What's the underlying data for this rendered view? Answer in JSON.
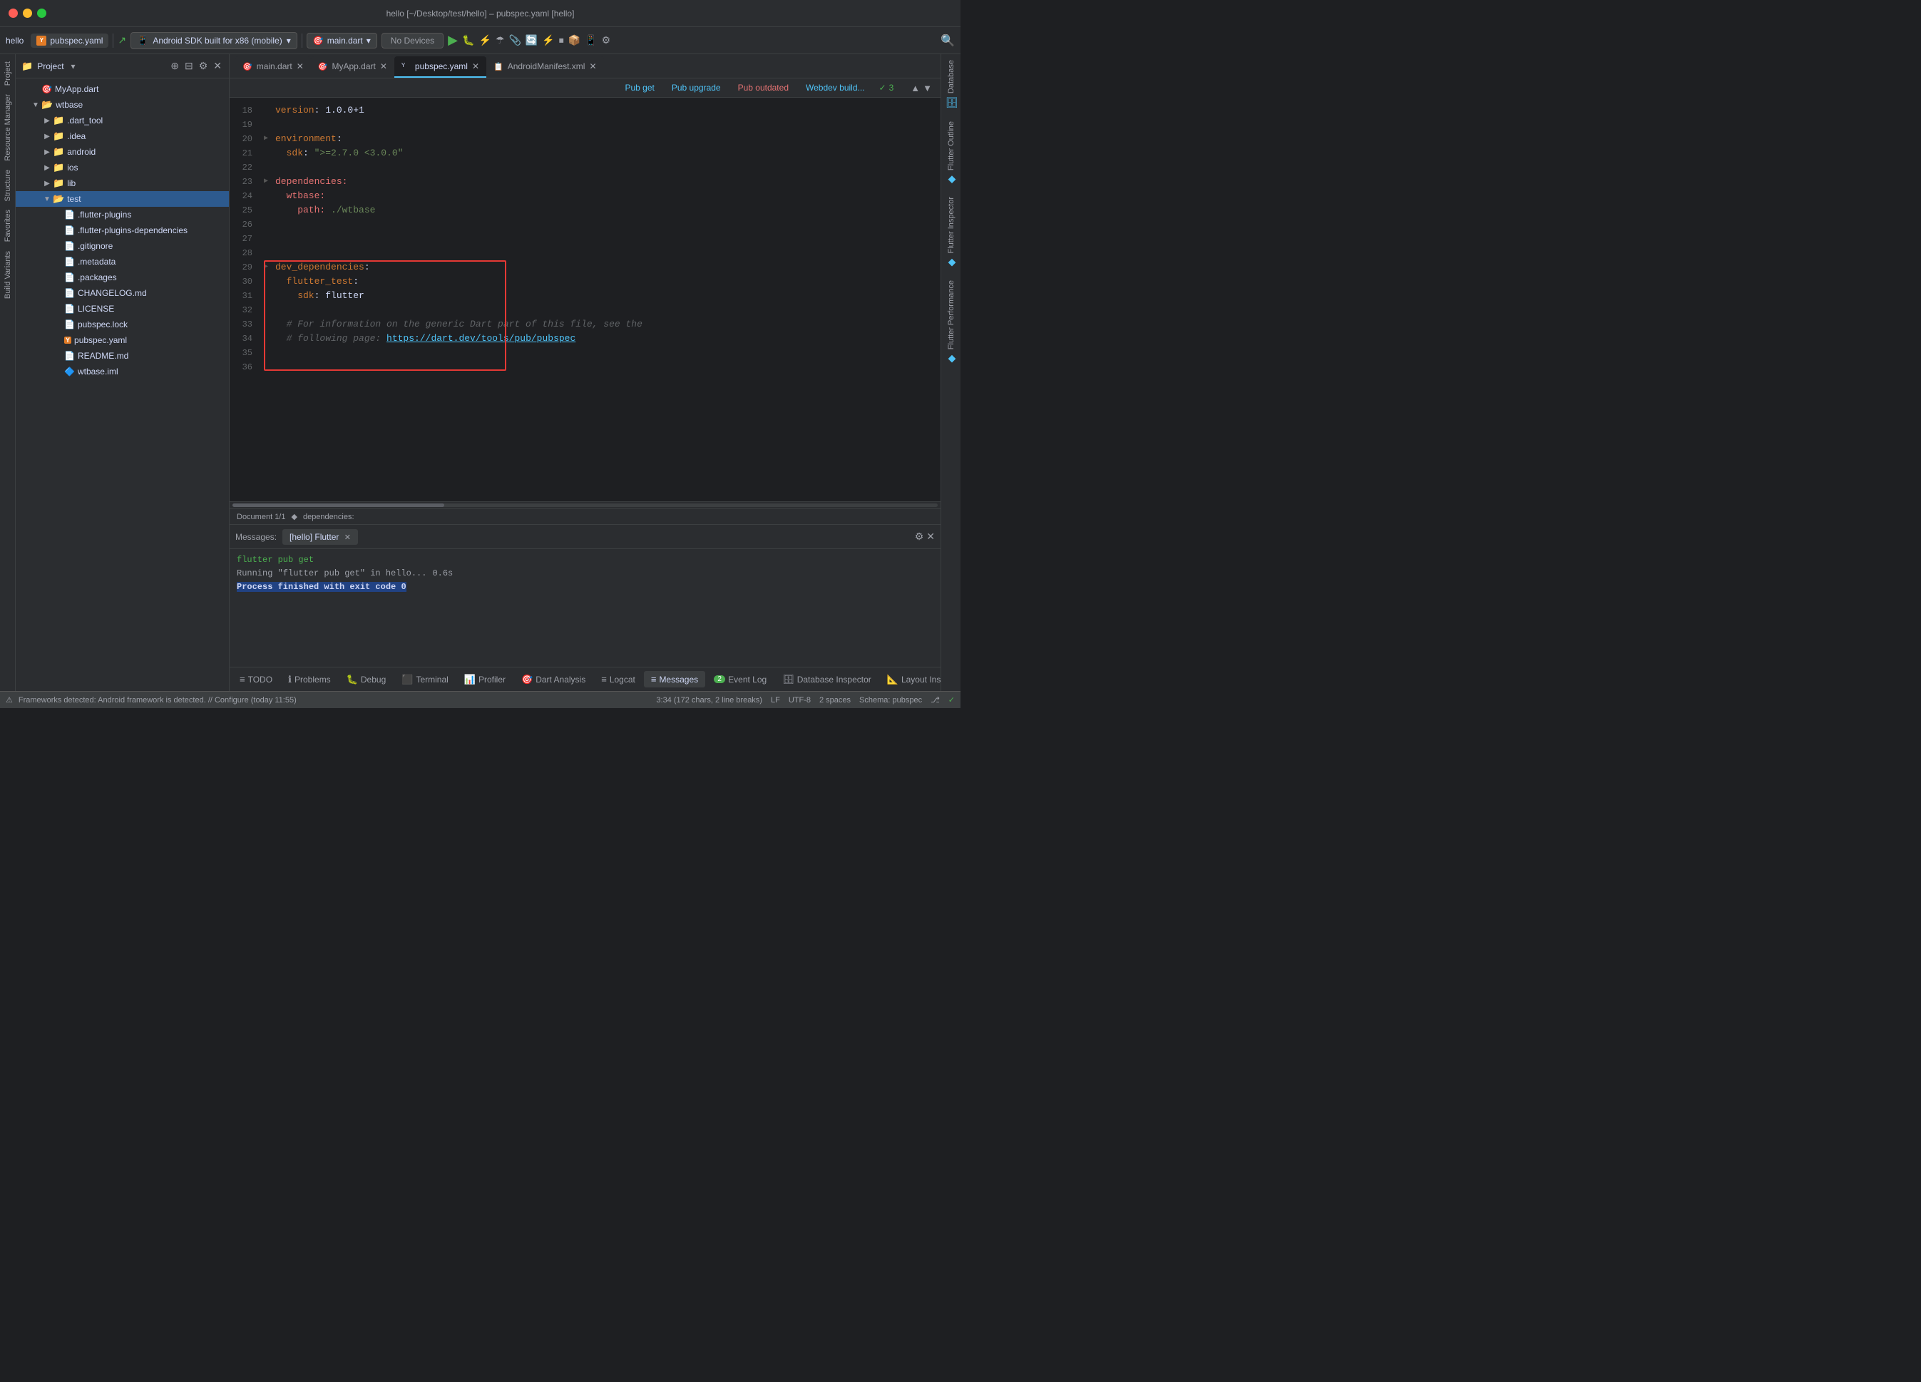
{
  "window": {
    "title": "hello [~/Desktop/test/hello] – pubspec.yaml [hello]",
    "traffic_lights": [
      "red",
      "yellow",
      "green"
    ]
  },
  "toolbar": {
    "project_label": "hello",
    "active_tab_label": "pubspec.yaml",
    "device_selector": "Android SDK built for x86 (mobile)",
    "main_dart": "main.dart",
    "no_devices": "No Devices",
    "run_icon": "▶",
    "debug_icon": "🐛"
  },
  "editor_tabs": [
    {
      "label": "main.dart",
      "icon": "dart",
      "active": false
    },
    {
      "label": "MyApp.dart",
      "icon": "dart",
      "active": false
    },
    {
      "label": "pubspec.yaml",
      "icon": "yaml",
      "active": true
    },
    {
      "label": "AndroidManifest.xml",
      "icon": "xml",
      "active": false
    }
  ],
  "pub_actions": {
    "pub_get": "Pub get",
    "pub_upgrade": "Pub upgrade",
    "pub_outdated": "Pub outdated",
    "webdev_build": "Webdev build...",
    "check_count": "3"
  },
  "code": {
    "lines": [
      {
        "num": 18,
        "content": "version: 1.0.0+1",
        "parts": [
          {
            "text": "version",
            "cls": "c-key"
          },
          {
            "text": ": "
          },
          {
            "text": "1.0.0+1",
            "cls": "c-version"
          }
        ]
      },
      {
        "num": 19,
        "content": "",
        "parts": []
      },
      {
        "num": 20,
        "content": "environment:",
        "parts": [
          {
            "text": "environment",
            "cls": "c-key"
          },
          {
            "text": ":"
          }
        ]
      },
      {
        "num": 21,
        "content": "  sdk: \">=2.7.0 <3.0.0\"",
        "parts": [
          {
            "text": "  sdk",
            "cls": "c-key"
          },
          {
            "text": ": "
          },
          {
            "text": "\">=2.7.0 <3.0.0\"",
            "cls": "c-str"
          }
        ]
      },
      {
        "num": 22,
        "content": "",
        "parts": []
      },
      {
        "num": 23,
        "content": "dependencies:",
        "parts": [
          {
            "text": "dependencies",
            "cls": "c-red"
          },
          {
            "text": ":"
          }
        ],
        "highlighted": true
      },
      {
        "num": 24,
        "content": "  wtbase:",
        "parts": [
          {
            "text": "  wtbase",
            "cls": "c-red"
          },
          {
            "text": ":"
          }
        ],
        "highlighted": true
      },
      {
        "num": 25,
        "content": "    path: ./wtbase",
        "parts": [
          {
            "text": "    path",
            "cls": "c-red"
          },
          {
            "text": ": "
          },
          {
            "text": "./wtbase",
            "cls": "c-str"
          }
        ],
        "highlighted": true
      },
      {
        "num": 26,
        "content": "",
        "parts": [],
        "highlighted": true
      },
      {
        "num": 27,
        "content": "",
        "parts": [],
        "highlighted": true
      },
      {
        "num": 28,
        "content": "",
        "parts": [],
        "highlighted": true
      },
      {
        "num": 29,
        "content": "dev_dependencies:",
        "parts": [
          {
            "text": "dev_dependencies",
            "cls": "c-key"
          },
          {
            "text": ":"
          }
        ]
      },
      {
        "num": 30,
        "content": "  flutter_test:",
        "parts": [
          {
            "text": "  flutter_test",
            "cls": "c-key"
          },
          {
            "text": ":"
          }
        ]
      },
      {
        "num": 31,
        "content": "    sdk: flutter",
        "parts": [
          {
            "text": "    sdk",
            "cls": "c-key"
          },
          {
            "text": ": "
          },
          {
            "text": "flutter",
            "cls": "c-version"
          }
        ]
      },
      {
        "num": 32,
        "content": "",
        "parts": []
      },
      {
        "num": 33,
        "content": "  # For information on the generic Dart part of this file, see the",
        "parts": [
          {
            "text": "  # For information on the generic Dart part of this file, see the",
            "cls": "c-comment"
          }
        ]
      },
      {
        "num": 34,
        "content": "  # following page: https://dart.dev/tools/pub/pubspec",
        "parts": [
          {
            "text": "  # following page: "
          },
          {
            "text": "https://dart.dev/tools/pub/pubspec",
            "cls": "c-url"
          }
        ]
      },
      {
        "num": 35,
        "content": "",
        "parts": []
      },
      {
        "num": 36,
        "content": "",
        "parts": []
      }
    ]
  },
  "editor_status": {
    "doc": "Document 1/1",
    "location": "dependencies:"
  },
  "project_tree": {
    "header": "Project",
    "items": [
      {
        "label": "MyApp.dart",
        "indent": 1,
        "type": "dart"
      },
      {
        "label": "wtbase",
        "indent": 1,
        "type": "folder",
        "expanded": true
      },
      {
        "label": ".dart_tool",
        "indent": 2,
        "type": "folder",
        "expanded": false
      },
      {
        "label": ".idea",
        "indent": 2,
        "type": "folder",
        "expanded": false
      },
      {
        "label": "android",
        "indent": 2,
        "type": "folder",
        "expanded": false
      },
      {
        "label": "ios",
        "indent": 2,
        "type": "folder",
        "expanded": false
      },
      {
        "label": "lib",
        "indent": 2,
        "type": "folder",
        "expanded": false
      },
      {
        "label": "test",
        "indent": 2,
        "type": "folder",
        "expanded": false,
        "selected": true
      },
      {
        "label": ".flutter-plugins",
        "indent": 3,
        "type": "file"
      },
      {
        "label": ".flutter-plugins-dependencies",
        "indent": 3,
        "type": "file"
      },
      {
        "label": ".gitignore",
        "indent": 3,
        "type": "file"
      },
      {
        "label": ".metadata",
        "indent": 3,
        "type": "file"
      },
      {
        "label": ".packages",
        "indent": 3,
        "type": "file"
      },
      {
        "label": "CHANGELOG.md",
        "indent": 3,
        "type": "file"
      },
      {
        "label": "LICENSE",
        "indent": 3,
        "type": "file"
      },
      {
        "label": "pubspec.lock",
        "indent": 3,
        "type": "file"
      },
      {
        "label": "pubspec.yaml",
        "indent": 3,
        "type": "yaml"
      },
      {
        "label": "README.md",
        "indent": 3,
        "type": "file"
      },
      {
        "label": "wtbase.iml",
        "indent": 3,
        "type": "iml"
      }
    ]
  },
  "bottom_panel": {
    "messages_label": "Messages:",
    "flutter_tab": "[hello] Flutter",
    "lines": [
      {
        "text": "flutter pub get",
        "cls": "cmd-line"
      },
      {
        "text": "Running \"flutter pub get\" in hello...",
        "cls": "info-line",
        "time": "0.6s"
      },
      {
        "text": "Process finished with exit code 0",
        "cls": "finish-line",
        "highlight": true
      }
    ]
  },
  "tool_tabs": [
    {
      "label": "TODO",
      "icon": "≡",
      "active": false
    },
    {
      "label": "Problems",
      "icon": "ℹ",
      "active": false
    },
    {
      "label": "Debug",
      "icon": "🐛",
      "active": false
    },
    {
      "label": "Terminal",
      "icon": "⬛",
      "active": false
    },
    {
      "label": "Profiler",
      "icon": "📊",
      "active": false
    },
    {
      "label": "Dart Analysis",
      "icon": "🎯",
      "active": false
    },
    {
      "label": "Logcat",
      "icon": "≡",
      "active": false
    },
    {
      "label": "Messages",
      "icon": "≡",
      "active": true
    },
    {
      "label": "Event Log",
      "icon": "2",
      "badge": true,
      "active": false
    },
    {
      "label": "Database Inspector",
      "icon": "🗄",
      "active": false
    },
    {
      "label": "Layout Inspector",
      "icon": "📐",
      "active": false
    }
  ],
  "status_bar": {
    "framework_msg": "Frameworks detected: Android framework is detected. // Configure (today 11:55)",
    "position": "3:34 (172 chars, 2 line breaks)",
    "encoding": "LF",
    "charset": "UTF-8",
    "indent": "2 spaces",
    "schema": "Schema: pubspec"
  },
  "right_sidebar_tabs": [
    {
      "label": "Database",
      "icon": "🗄"
    },
    {
      "label": "Flutter Outline",
      "icon": "◆"
    },
    {
      "label": "Flutter Inspector",
      "icon": "◆"
    },
    {
      "label": "Flutter Performance",
      "icon": "◆"
    }
  ],
  "left_sidebar_tabs": [
    {
      "label": "Project"
    },
    {
      "label": "Resource Manager"
    },
    {
      "label": "Structure"
    },
    {
      "label": "Favorites"
    },
    {
      "label": "Build Variants"
    }
  ]
}
